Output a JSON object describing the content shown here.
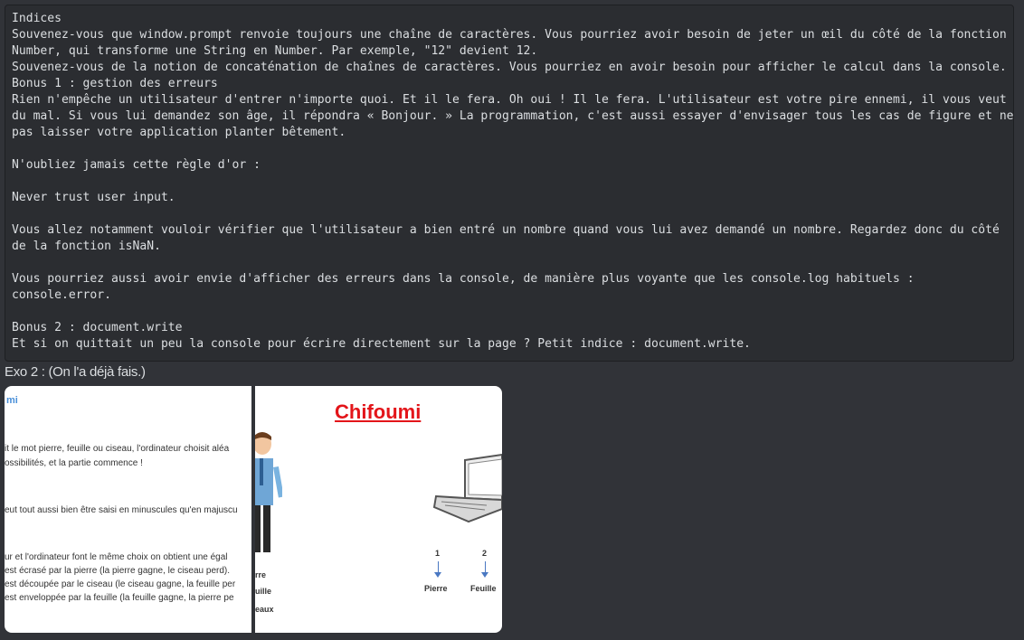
{
  "code_block": {
    "lines": [
      "Indices",
      "Souvenez-vous que window.prompt renvoie toujours une chaîne de caractères. Vous pourriez avoir besoin de jeter un œil du côté de la fonction",
      "Number, qui transforme une String en Number. Par exemple, \"12\" devient 12.",
      "Souvenez-vous de la notion de concaténation de chaînes de caractères. Vous pourriez en avoir besoin pour afficher le calcul dans la console.",
      "Bonus 1 : gestion des erreurs",
      "Rien n'empêche un utilisateur d'entrer n'importe quoi. Et il le fera. Oh oui ! Il le fera. L'utilisateur est votre pire ennemi, il vous veut",
      "du mal. Si vous lui demandez son âge, il répondra « Bonjour. » La programmation, c'est aussi essayer d'envisager tous les cas de figure et ne",
      "pas laisser votre application planter bêtement.",
      "",
      "N'oubliez jamais cette règle d'or :",
      "",
      "Never trust user input.",
      "",
      "Vous allez notamment vouloir vérifier que l'utilisateur a bien entré un nombre quand vous lui avez demandé un nombre. Regardez donc du côté",
      "de la fonction isNaN.",
      "",
      "Vous pourriez aussi avoir envie d'afficher des erreurs dans la console, de manière plus voyante que les console.log habituels :",
      "console.error.",
      "",
      "Bonus 2 : document.write",
      "Et si on quittait un peu la console pour écrire directement sur la page ? Petit indice : document.write."
    ]
  },
  "message": {
    "text": "Exo 2 : (On l'a déjà fais.)"
  },
  "attachment1": {
    "title": "mi",
    "lines": [
      "it le mot pierre, feuille ou ciseau, l'ordinateur choisit aléa",
      "ossibilités, et la partie commence !",
      "eut tout aussi bien être saisi en minuscules qu'en majuscu",
      "ur et l'ordinateur font le même choix on obtient une égal",
      "est écrasé par la pierre (la pierre gagne, le ciseau perd).",
      "est découpée par le ciseau (le ciseau gagne, la feuille per",
      "est enveloppée par la feuille (la feuille gagne, la pierre pe"
    ]
  },
  "attachment2": {
    "title": "Chifoumi",
    "labels": [
      "rre",
      "uille",
      "eaux"
    ],
    "choices": [
      {
        "number": "1",
        "name": "Pierre"
      },
      {
        "number": "2",
        "name": "Feuille"
      }
    ]
  }
}
